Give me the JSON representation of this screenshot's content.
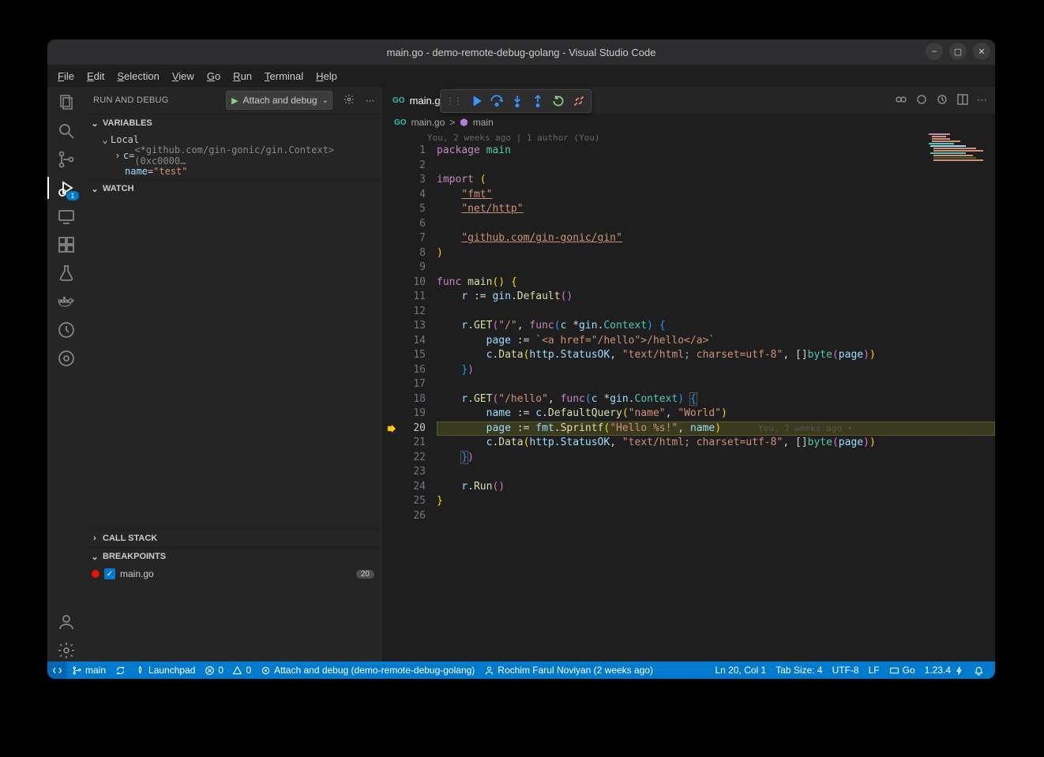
{
  "title": "main.go - demo-remote-debug-golang - Visual Studio Code",
  "menu": [
    "File",
    "Edit",
    "Selection",
    "View",
    "Go",
    "Run",
    "Terminal",
    "Help"
  ],
  "sidebar": {
    "title": "RUN AND DEBUG",
    "config": "Attach and debug",
    "sections": {
      "variables": "VARIABLES",
      "local": "Local",
      "watch": "WATCH",
      "callstack": "CALL STACK",
      "breakpoints": "BREAKPOINTS"
    },
    "vars": {
      "c_name": "c",
      "c_eq": " = ",
      "c_val": "<*github.com/gin-gonic/gin.Context>(0xc0000…",
      "name_name": "name",
      "name_eq": " = ",
      "name_val": "\"test\""
    },
    "bp": {
      "file": "main.go",
      "line": "20"
    }
  },
  "activity_badge": "1",
  "tab": {
    "name": "main.go"
  },
  "crumbs": {
    "file": "main.go",
    "sep": ">",
    "sym": "main"
  },
  "blame": "You, 2 weeks ago | 1 author (You)",
  "code": {
    "lines": [
      "1",
      "2",
      "3",
      "4",
      "5",
      "6",
      "7",
      "8",
      "9",
      "10",
      "11",
      "12",
      "13",
      "14",
      "15",
      "16",
      "17",
      "18",
      "19",
      "20",
      "21",
      "22",
      "23",
      "24",
      "25",
      "26"
    ],
    "l1a": "package ",
    "l1b": "main",
    "l3a": "import ",
    "l3b": "(",
    "l4": "\"fmt\"",
    "l5": "\"net/http\"",
    "l7": "\"github.com/gin-gonic/gin\"",
    "l8": ")",
    "l10a": "func ",
    "l10b": "main",
    "l10c": "() {",
    "l11a": "r",
    "l11b": " := ",
    "l11c": "gin",
    "l11d": ".",
    "l11e": "Default",
    "l11f": "()",
    "l13a": "r",
    "l13b": ".",
    "l13c": "GET",
    "l13d": "(",
    "l13e": "\"/\"",
    "l13f": ", ",
    "l13g": "func",
    "l13h": "(",
    "l13i": "c",
    "l13j": " *",
    "l13k": "gin",
    "l13l": ".",
    "l13m": "Context",
    "l13n": ") {",
    "l14a": "page",
    "l14b": " := ",
    "l14c": "`<a href=\"/hello\">/hello</a>`",
    "l15a": "c",
    "l15b": ".",
    "l15c": "Data",
    "l15d": "(",
    "l15e": "http",
    "l15f": ".",
    "l15g": "StatusOK",
    "l15h": ", ",
    "l15i": "\"text/html; charset=utf-8\"",
    "l15j": ", []",
    "l15k": "byte",
    "l15l": "(",
    "l15m": "page",
    "l15n": "))",
    "l16": "})",
    "l18a": "r",
    "l18b": ".",
    "l18c": "GET",
    "l18d": "(",
    "l18e": "\"/hello\"",
    "l18f": ", ",
    "l18g": "func",
    "l18h": "(",
    "l18i": "c",
    "l18j": " *",
    "l18k": "gin",
    "l18l": ".",
    "l18m": "Context",
    "l18n": ") {",
    "l19a": "name",
    "l19b": " := ",
    "l19c": "c",
    "l19d": ".",
    "l19e": "DefaultQuery",
    "l19f": "(",
    "l19g": "\"name\"",
    "l19h": ", ",
    "l19i": "\"World\"",
    "l19j": ")",
    "l20a": "page",
    "l20b": " := ",
    "l20c": "fmt",
    "l20d": ".",
    "l20e": "Sprintf",
    "l20f": "(",
    "l20g": "\"Hello %s!\"",
    "l20h": ", ",
    "l20i": "name",
    "l20j": ")",
    "l20_blame": "You, 2 weeks ago •",
    "l21a": "c",
    "l21b": ".",
    "l21c": "Data",
    "l21d": "(",
    "l21e": "http",
    "l21f": ".",
    "l21g": "StatusOK",
    "l21h": ", ",
    "l21i": "\"text/html; charset=utf-8\"",
    "l21j": ", []",
    "l21k": "byte",
    "l21l": "(",
    "l21m": "page",
    "l21n": "))",
    "l22": "})",
    "l24a": "r",
    "l24b": ".",
    "l24c": "Run",
    "l24d": "()",
    "l25": "}"
  },
  "status": {
    "branch": "main",
    "launchpad": "Launchpad",
    "errors": "0",
    "warnings": "0",
    "debug": "Attach and debug (demo-remote-debug-golang)",
    "author": "Rochim Farul Noviyan (2 weeks ago)",
    "pos": "Ln 20, Col 1",
    "tab": "Tab Size: 4",
    "enc": "UTF-8",
    "eol": "LF",
    "lang": "Go",
    "ver": "1.23.4"
  }
}
